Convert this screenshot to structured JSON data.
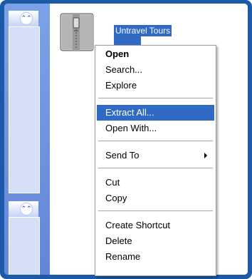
{
  "window": {
    "frame_color": "#1a5aa8",
    "taskpane_color": "#6b8fdf",
    "selection_color": "#316ac5"
  },
  "taskpane": {
    "collapse_icon": "double-chevron-up-icon"
  },
  "file": {
    "name": "Untravel Tours",
    "icon": "zip-folder-icon"
  },
  "context_menu": {
    "items": [
      {
        "label": "Open",
        "bold": true
      },
      {
        "label": "Search..."
      },
      {
        "label": "Explore"
      },
      {
        "label": "Extract All...",
        "selected": true
      },
      {
        "label": "Open With..."
      },
      {
        "label": "Send To",
        "submenu": true
      },
      {
        "label": "Cut"
      },
      {
        "label": "Copy"
      },
      {
        "label": "Create Shortcut"
      },
      {
        "label": "Delete"
      },
      {
        "label": "Rename"
      }
    ]
  }
}
